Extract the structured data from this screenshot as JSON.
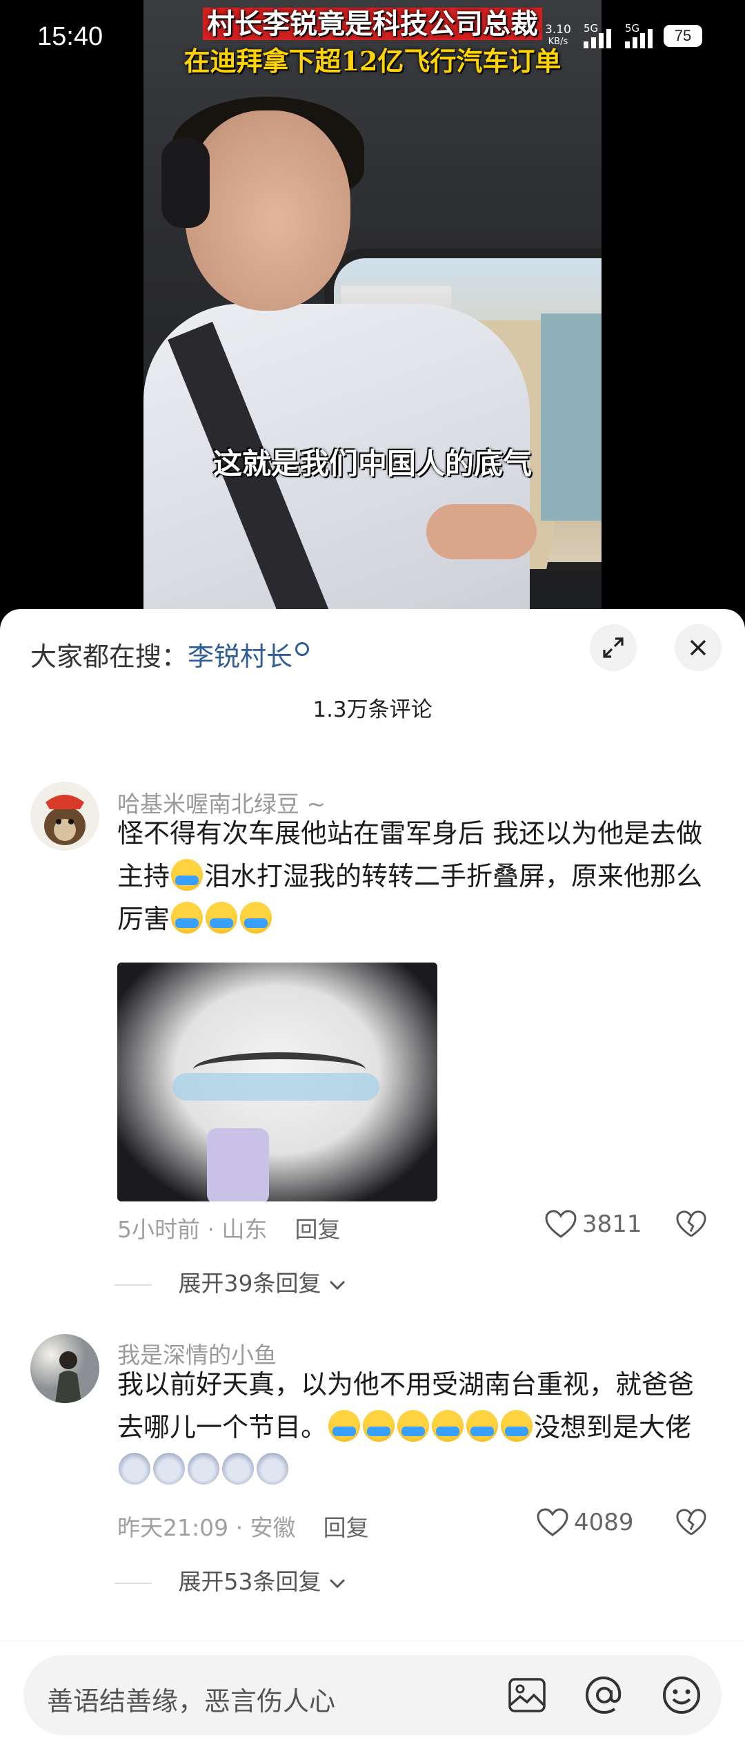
{
  "status_bar": {
    "time": "15:40",
    "net_speed": "3.10",
    "net_unit": "KB/s",
    "signal1_label": "5G",
    "signal2_label": "5G",
    "battery": "75"
  },
  "video": {
    "title_line1": "村长李锐竟是科技公司总裁",
    "title_line2": "在迪拜拿下超12亿飞行汽车订单",
    "caption": "这就是我们中国人的底气"
  },
  "comments_panel": {
    "search_prefix": "大家都在搜：",
    "search_keyword": "李锐村长",
    "count_label": "1.3万条评论",
    "comments": [
      {
        "username": "哈基米喔南北绿豆 ~",
        "text_part1": "怪不得有次车展他站在雷军身后  我还以为他是去做主持",
        "text_part2": "泪水打湿我的转转二手折叠屏，原来他那么厉害",
        "time_location": "5小时前 · 山东",
        "reply_label": "回复",
        "likes": "3811",
        "expand_label": "展开39条回复"
      },
      {
        "username": "我是深情的小鱼",
        "text_part1": "我以前好天真，以为他不用受湖南台重视，就爸爸去哪儿一个节目。",
        "text_part2": "没想到是大佬",
        "time_location": "昨天21:09 · 安徽",
        "reply_label": "回复",
        "likes": "4089",
        "expand_label": "展开53条回复"
      }
    ]
  },
  "input_bar": {
    "placeholder": "善语结善缘，恶言伤人心"
  },
  "colors": {
    "accent_blue": "#2f5d9a",
    "title_red": "#d21f1f",
    "title_yellow": "#ffd400"
  }
}
